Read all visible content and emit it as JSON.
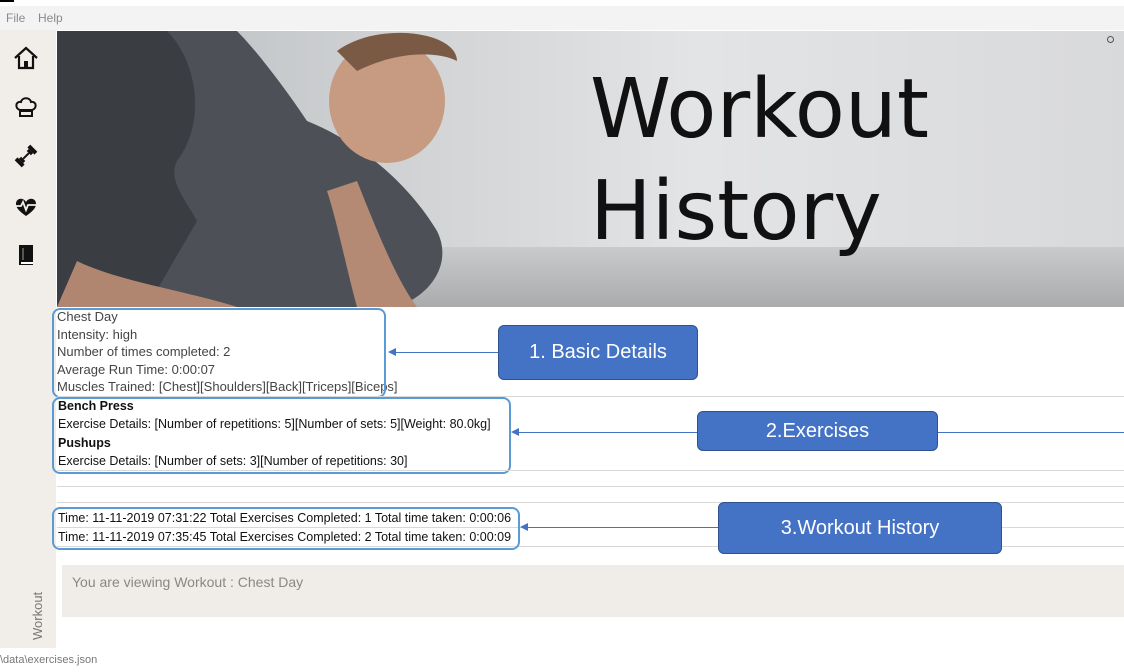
{
  "menu": {
    "file": "File",
    "help": "Help"
  },
  "sidebar": {
    "icons": [
      "home-icon",
      "chef-hat-icon",
      "dumbbell-icon",
      "heartbeat-icon",
      "book-icon"
    ],
    "label": "Workout"
  },
  "banner": {
    "title_line1": "Workout",
    "title_line2": "History"
  },
  "details": {
    "name": "Chest Day",
    "intensity": "Intensity: high",
    "times_completed": "Number of times completed: 2",
    "avg_run_time": "Average Run Time: 0:00:07",
    "muscles": "Muscles Trained: [Chest][Shoulders][Back][Triceps][Biceps]"
  },
  "exercises": [
    {
      "name": "Bench Press",
      "details": "Exercise Details: [Number of repetitions: 5][Number of sets: 5][Weight: 80.0kg]"
    },
    {
      "name": "Pushups",
      "details": "Exercise Details: [Number of sets: 3][Number of repetitions: 30]"
    }
  ],
  "history": [
    "Time: 11-11-2019 07:31:22   Total Exercises Completed: 1   Total time taken: 0:00:06",
    "Time: 11-11-2019 07:35:45   Total Exercises Completed: 2   Total time taken: 0:00:09"
  ],
  "callouts": {
    "basic": "1. Basic Details",
    "exercises": "2.Exercises",
    "history": "3.Workout History"
  },
  "result_text": "You are viewing Workout : Chest Day",
  "status": "\\data\\exercises.json",
  "colors": {
    "callout_fill": "#4472c4",
    "callout_border": "#5b9bd5"
  }
}
